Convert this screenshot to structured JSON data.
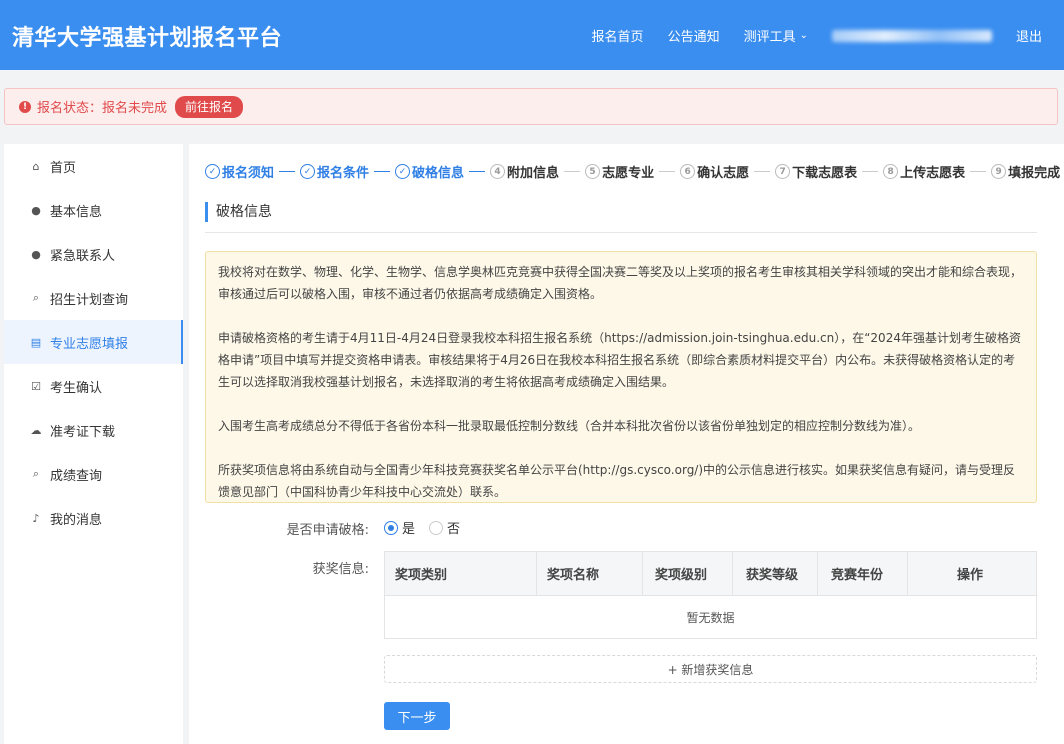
{
  "header": {
    "brand": "清华大学强基计划报名平台",
    "nav": {
      "home": "报名首页",
      "notice": "公告通知",
      "tools": "测评工具",
      "logout": "退出"
    }
  },
  "status": {
    "text": "报名状态：报名未完成",
    "button": "前往报名"
  },
  "sidebar": {
    "items": [
      {
        "label": "首页",
        "icon": "home-icon"
      },
      {
        "label": "基本信息",
        "icon": "user-icon"
      },
      {
        "label": "紧急联系人",
        "icon": "user-icon"
      },
      {
        "label": "招生计划查询",
        "icon": "search-icon"
      },
      {
        "label": "专业志愿填报",
        "icon": "document-icon"
      },
      {
        "label": "考生确认",
        "icon": "check-square-icon"
      },
      {
        "label": "准考证下载",
        "icon": "cloud-download-icon"
      },
      {
        "label": "成绩查询",
        "icon": "search-icon"
      },
      {
        "label": "我的消息",
        "icon": "bell-icon"
      }
    ]
  },
  "steps": [
    {
      "num": "✓",
      "label": "报名须知"
    },
    {
      "num": "✓",
      "label": "报名条件"
    },
    {
      "num": "✓",
      "label": "破格信息"
    },
    {
      "num": "4",
      "label": "附加信息"
    },
    {
      "num": "5",
      "label": "志愿专业"
    },
    {
      "num": "6",
      "label": "确认志愿"
    },
    {
      "num": "7",
      "label": "下载志愿表"
    },
    {
      "num": "8",
      "label": "上传志愿表"
    },
    {
      "num": "9",
      "label": "填报完成"
    }
  ],
  "section": {
    "title": "破格信息"
  },
  "notice": {
    "p1": "我校将对在数学、物理、化学、生物学、信息学奥林匹克竞赛中获得全国决赛二等奖及以上奖项的报名考生审核其相关学科领域的突出才能和综合表现，审核通过后可以破格入围，审核不通过者仍依据高考成绩确定入围资格。",
    "p2": "申请破格资格的考生请于4月11日-4月24日登录我校本科招生报名系统（https://admission.join-tsinghua.edu.cn），在“2024年强基计划考生破格资格申请”项目中填写并提交资格申请表。审核结果将于4月26日在我校本科招生报名系统（即综合素质材料提交平台）内公布。未获得破格资格认定的考生可以选择取消我校强基计划报名，未选择取消的考生将依据高考成绩确定入围结果。",
    "p3": "入围考生高考成绩总分不得低于各省份本科一批录取最低控制分数线（合并本科批次省份以该省份单独划定的相应控制分数线为准）。",
    "p4": "所获奖项信息将由系统自动与全国青少年科技竞赛获奖名单公示平台(http://gs.cysco.org/)中的公示信息进行核实。如果获奖信息有疑问，请与受理反馈意见部门（中国科协青少年科技中心交流处）联系。"
  },
  "form": {
    "apply_label": "是否申请破格:",
    "yes": "是",
    "no": "否",
    "award_label": "获奖信息:"
  },
  "table": {
    "columns": [
      "奖项类别",
      "奖项名称",
      "奖项级别",
      "获奖等级",
      "竞赛年份",
      "操作"
    ],
    "empty": "暂无数据"
  },
  "buttons": {
    "add": "+ 新增获奖信息",
    "next": "下一步"
  },
  "colors": {
    "primary": "#3a8ef0",
    "danger": "#e04a4a",
    "notice_bg": "#fdf8e8"
  }
}
